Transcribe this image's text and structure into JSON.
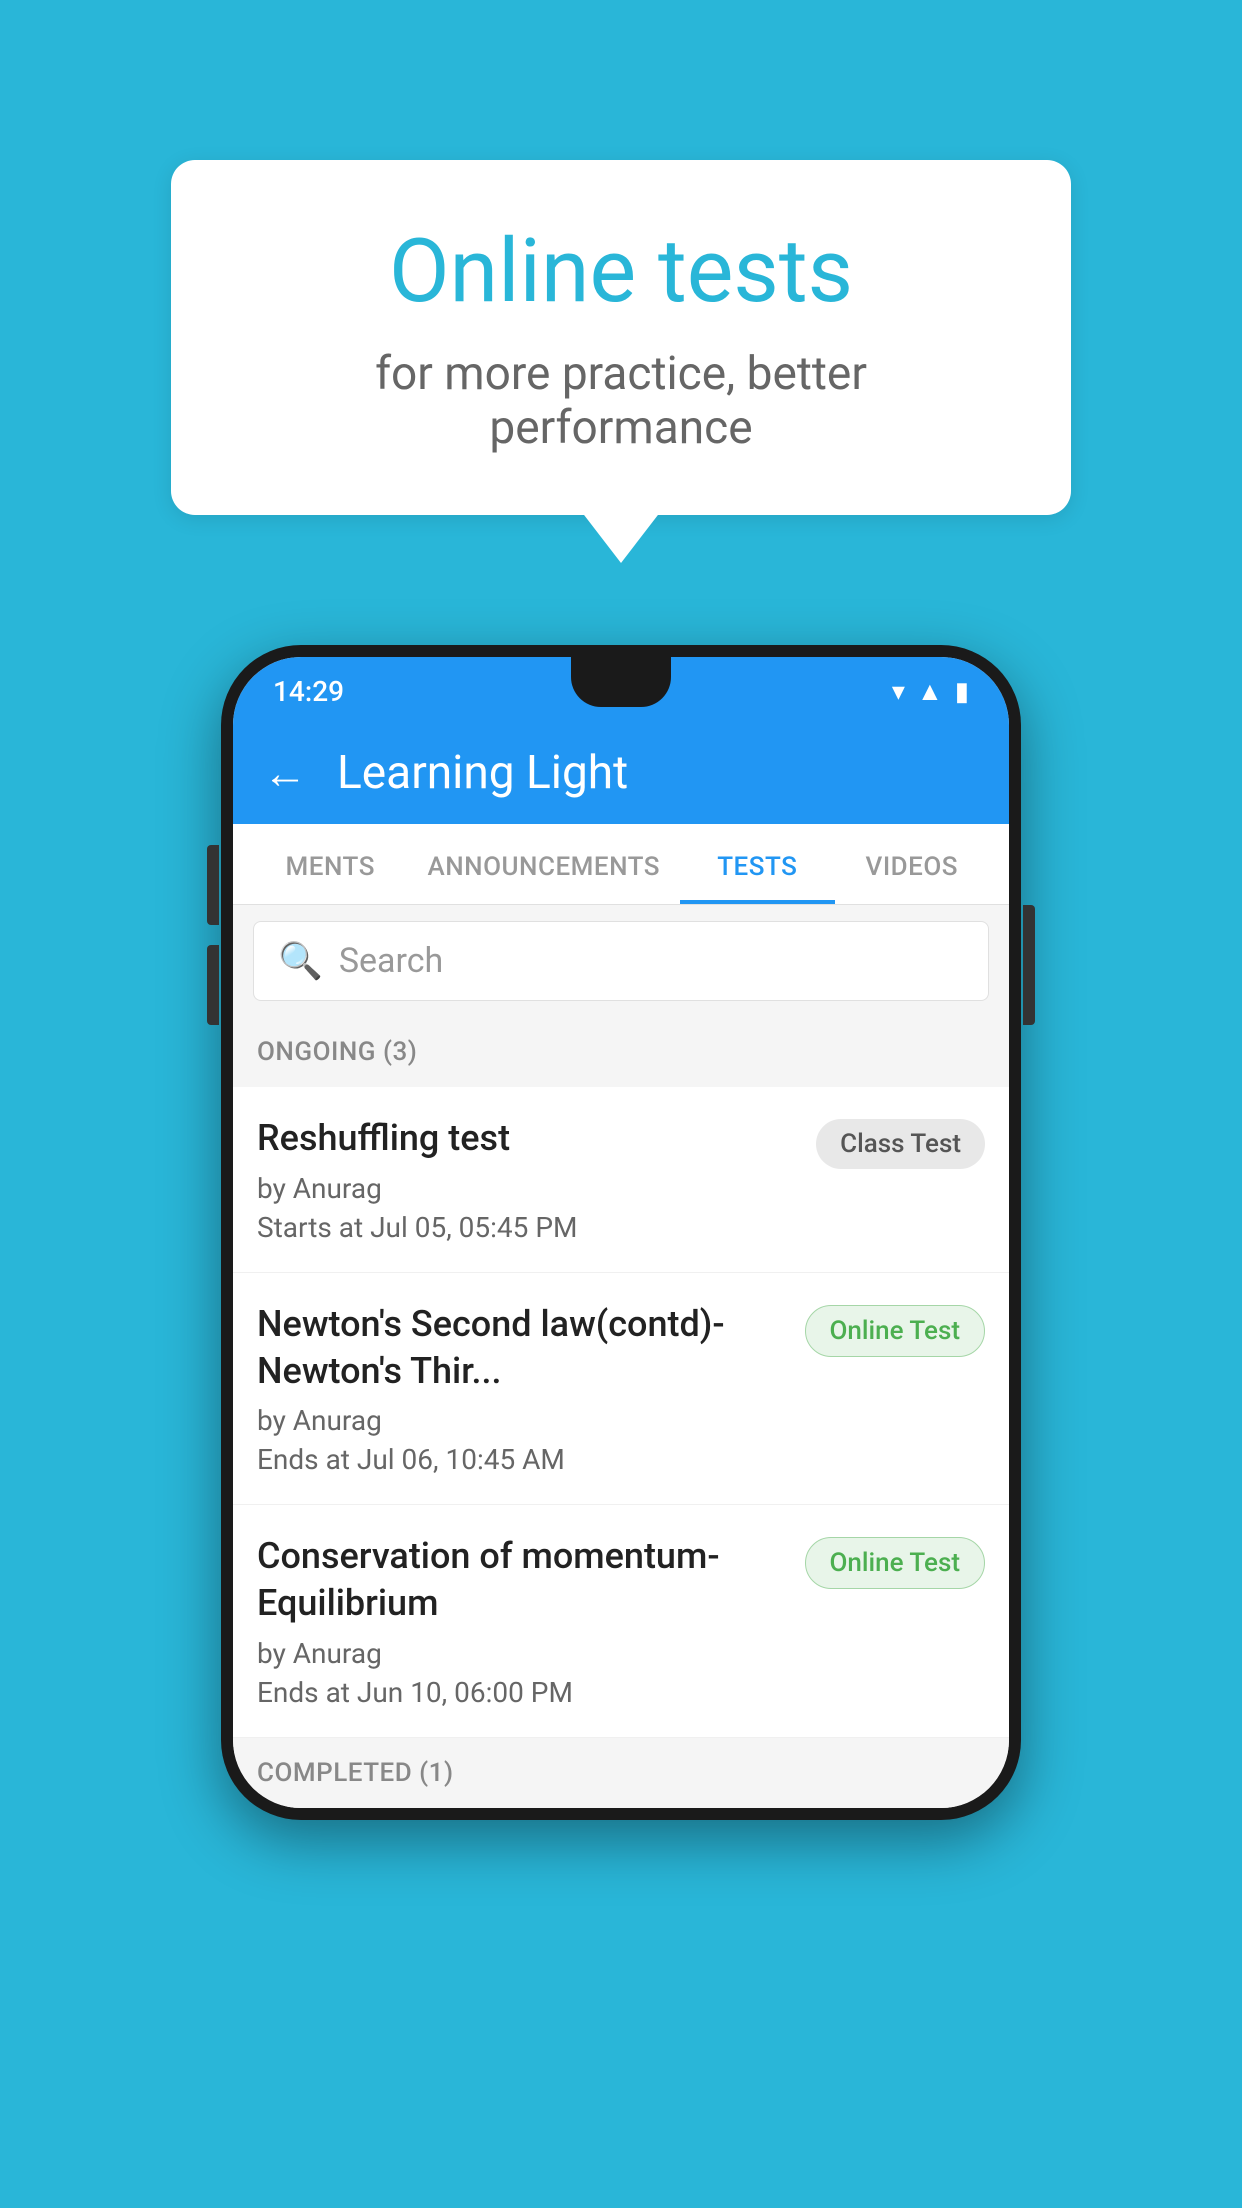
{
  "background_color": "#29b6d8",
  "speech_bubble": {
    "title": "Online tests",
    "subtitle": "for more practice, better performance"
  },
  "phone": {
    "status_bar": {
      "time": "14:29",
      "wifi": "▾",
      "signal": "▲",
      "battery": "▮"
    },
    "app_bar": {
      "back_label": "←",
      "title": "Learning Light"
    },
    "tabs": [
      {
        "label": "MENTS",
        "active": false
      },
      {
        "label": "ANNOUNCEMENTS",
        "active": false
      },
      {
        "label": "TESTS",
        "active": true
      },
      {
        "label": "VIDEOS",
        "active": false
      }
    ],
    "search": {
      "placeholder": "Search"
    },
    "ongoing_section": {
      "header": "ONGOING (3)",
      "items": [
        {
          "title": "Reshuffling test",
          "author": "by Anurag",
          "date": "Starts at  Jul 05, 05:45 PM",
          "badge_label": "Class Test",
          "badge_type": "class"
        },
        {
          "title": "Newton's Second law(contd)-Newton's Thir...",
          "author": "by Anurag",
          "date": "Ends at  Jul 06, 10:45 AM",
          "badge_label": "Online Test",
          "badge_type": "online"
        },
        {
          "title": "Conservation of momentum-Equilibrium",
          "author": "by Anurag",
          "date": "Ends at  Jun 10, 06:00 PM",
          "badge_label": "Online Test",
          "badge_type": "online"
        }
      ]
    },
    "completed_section": {
      "header": "COMPLETED (1)"
    }
  }
}
